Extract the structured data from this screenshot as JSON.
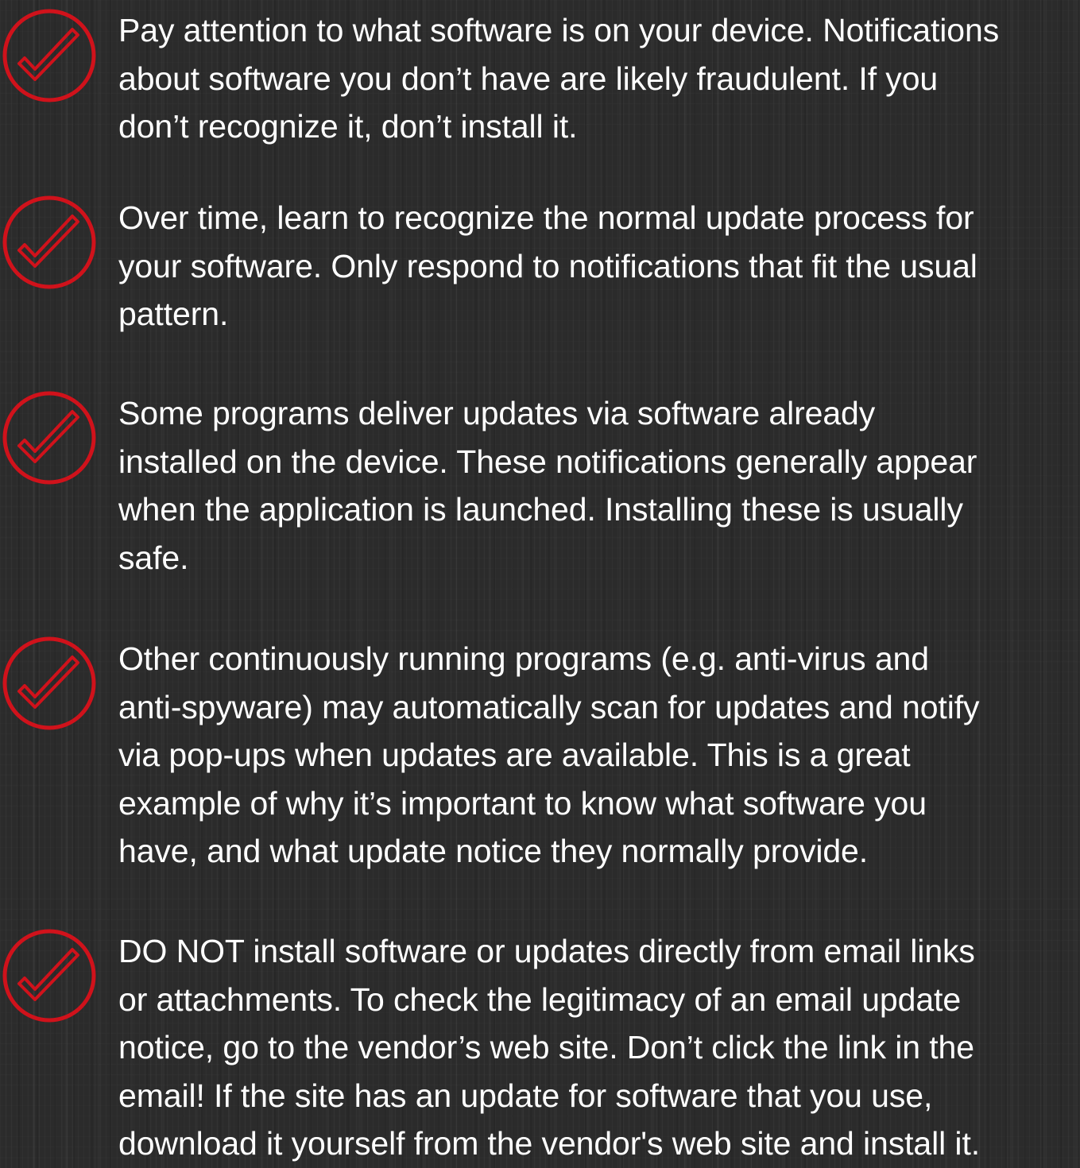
{
  "accent_color": "#d0121b",
  "text_color": "#ffffff",
  "background_color": "#2b2b2b",
  "tips": [
    {
      "icon": "check-circle-icon",
      "text": "Pay attention to what software is on your device. Notifications\nabout software you don’t have are likely fraudulent. If you\ndon’t recognize it, don’t install it."
    },
    {
      "icon": "check-circle-icon",
      "text": "Over time, learn to recognize the normal update process for\nyour software. Only respond to notifications that fit the usual\npattern."
    },
    {
      "icon": "check-circle-icon",
      "text": "Some programs deliver updates via software already\ninstalled on the device. These notifications generally appear\nwhen the application is launched. Installing these is usually\nsafe."
    },
    {
      "icon": "check-circle-icon",
      "text": "Other continuously running programs (e.g. anti-virus and\nanti-spyware) may automatically scan for updates and notify\nvia pop-ups when updates are available. This is a great\nexample of why it’s important to know what software you\nhave, and what update notice they normally provide."
    },
    {
      "icon": "check-circle-icon",
      "text": "DO NOT install software or updates directly from email links\nor attachments. To check the legitimacy of an email update\nnotice, go to the vendor’s web site. Don’t click the link in the\nemail! If the site has an update for software that you use,\ndownload it yourself from the vendor's web site and install it."
    }
  ]
}
